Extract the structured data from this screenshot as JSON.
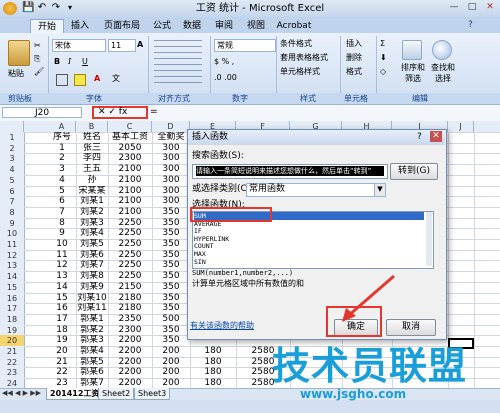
{
  "titlebar": {
    "title": "工资 统计 - Microsoft Excel",
    "office_icon": "office-logo",
    "qat": [
      "save-icon",
      "undo-icon",
      "redo-icon",
      "dropdown-icon"
    ],
    "controls": [
      "—",
      "□",
      "✕"
    ]
  },
  "tabs": [
    "开始",
    "插入",
    "页面布局",
    "公式",
    "数据",
    "审阅",
    "视图",
    "Acrobat"
  ],
  "ribbon": {
    "paste_label": "粘贴",
    "font_name": "宋体",
    "font_size": "11",
    "number_format": "常规",
    "style_items": [
      "条件格式",
      "套用表格格式",
      "单元格样式"
    ],
    "cell_items": [
      "插入",
      "删除",
      "格式"
    ],
    "edit_items": [
      "排序和筛选",
      "查找和选择"
    ],
    "groups": [
      "剪贴板",
      "字体",
      "对齐方式",
      "数字",
      "样式",
      "单元格",
      "编辑"
    ]
  },
  "formula_bar": {
    "name_box": "J20",
    "symbols": "✕ ✓ fx",
    "equals": "="
  },
  "grid": {
    "columns": [
      "A",
      "B",
      "C",
      "D",
      "E",
      "F",
      "G",
      "H",
      "I",
      "J"
    ],
    "rows": [
      [
        "序号",
        "姓名",
        "基本工资",
        "全勤奖",
        "餐补",
        "工资总额"
      ],
      [
        "1",
        "张三",
        "2050",
        "300",
        "",
        ""
      ],
      [
        "2",
        "李四",
        "2300",
        "300",
        "",
        ""
      ],
      [
        "3",
        "王五",
        "2100",
        "300",
        "",
        ""
      ],
      [
        "4",
        "孙",
        "2100",
        "300",
        "",
        ""
      ],
      [
        "5",
        "宋某某",
        "2100",
        "300",
        "",
        ""
      ],
      [
        "6",
        "刘某1",
        "2100",
        "300",
        "",
        ""
      ],
      [
        "7",
        "刘某2",
        "2100",
        "350",
        "",
        ""
      ],
      [
        "8",
        "刘某3",
        "2250",
        "350",
        "",
        ""
      ],
      [
        "9",
        "刘某4",
        "2250",
        "350",
        "",
        ""
      ],
      [
        "10",
        "刘某5",
        "2250",
        "350",
        "",
        ""
      ],
      [
        "11",
        "刘某6",
        "2250",
        "350",
        "",
        ""
      ],
      [
        "12",
        "刘某7",
        "2250",
        "350",
        "",
        ""
      ],
      [
        "13",
        "刘某8",
        "2250",
        "350",
        "",
        ""
      ],
      [
        "14",
        "刘某9",
        "2150",
        "350",
        "",
        ""
      ],
      [
        "15",
        "刘某10",
        "2180",
        "350",
        "",
        ""
      ],
      [
        "16",
        "刘某11",
        "2180",
        "350",
        "",
        ""
      ],
      [
        "17",
        "郭某1",
        "2350",
        "500",
        "",
        ""
      ],
      [
        "18",
        "郭某2",
        "2300",
        "350",
        "",
        ""
      ],
      [
        "19",
        "郭某3",
        "2200",
        "350",
        "",
        ""
      ],
      [
        "20",
        "郭某4",
        "2200",
        "200",
        "180",
        "2580"
      ],
      [
        "21",
        "郭某5",
        "2200",
        "200",
        "180",
        "2580"
      ],
      [
        "22",
        "郭某6",
        "2200",
        "200",
        "180",
        "2580"
      ],
      [
        "23",
        "郭某7",
        "2200",
        "200",
        "180",
        "2580"
      ]
    ],
    "row_numbers": [
      "1",
      "2",
      "3",
      "4",
      "5",
      "6",
      "7",
      "8",
      "9",
      "10",
      "11",
      "12",
      "13",
      "14",
      "15",
      "16",
      "17",
      "18",
      "19",
      "20",
      "21",
      "22",
      "23",
      "24"
    ]
  },
  "sheets": [
    "201412工资",
    "Sheet2",
    "Sheet3"
  ],
  "dialog": {
    "title": "插入函数",
    "search_label": "搜索函数(S):",
    "search_value": "请输入一条简短说明来描述您想做什么，然后单击“转到”",
    "go_button": "转到(G)",
    "category_label": "或选择类别(C):",
    "category_value": "常用函数",
    "select_label": "选择函数(N):",
    "functions": [
      "SUM",
      "AVERAGE",
      "IF",
      "HYPERLINK",
      "COUNT",
      "MAX",
      "SIN"
    ],
    "selected_function": "SUM",
    "signature": "SUM(number1,number2,...)",
    "description": "计算单元格区域中所有数值的和",
    "help_link": "有关该函数的帮助",
    "ok_button": "确定",
    "cancel_button": "取消",
    "close_icon": "✕",
    "help_icon": "?"
  },
  "watermark": {
    "main": "技术员联盟",
    "url": "www.jsgho.com"
  },
  "colors": {
    "highlight": "#e3372e",
    "select": "#3169c6",
    "brand": "#1a9ed8"
  }
}
